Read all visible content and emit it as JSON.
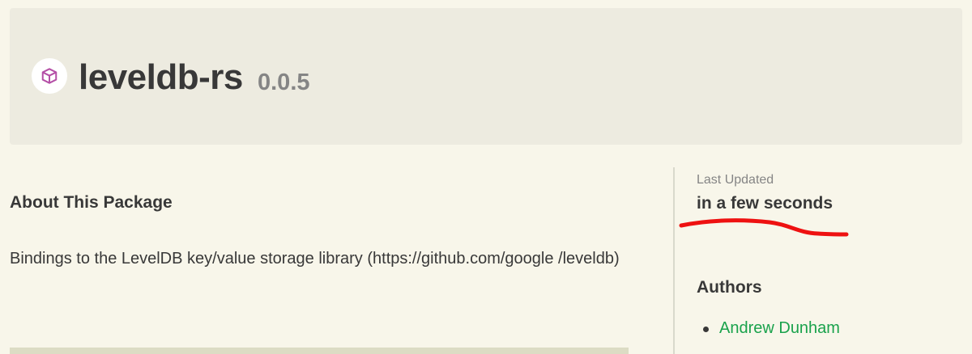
{
  "header": {
    "crate_name": "leveldb-rs",
    "version": "0.0.5",
    "logo_icon": "package-box-icon"
  },
  "about": {
    "heading": "About This Package",
    "description": "Bindings to the LevelDB key/value storage library (https://github.com/google /leveldb)"
  },
  "sidebar": {
    "last_updated_label": "Last Updated",
    "last_updated_value": "in a few seconds",
    "authors_heading": "Authors",
    "authors": [
      "Andrew Dunham"
    ]
  },
  "colors": {
    "page_bg": "#f8f6ea",
    "header_bg": "#edebe0",
    "text": "#383838",
    "muted": "#858585",
    "link": "#1aa24c",
    "logo_accent": "#b44fa6",
    "annotation_red": "#ee1111"
  }
}
